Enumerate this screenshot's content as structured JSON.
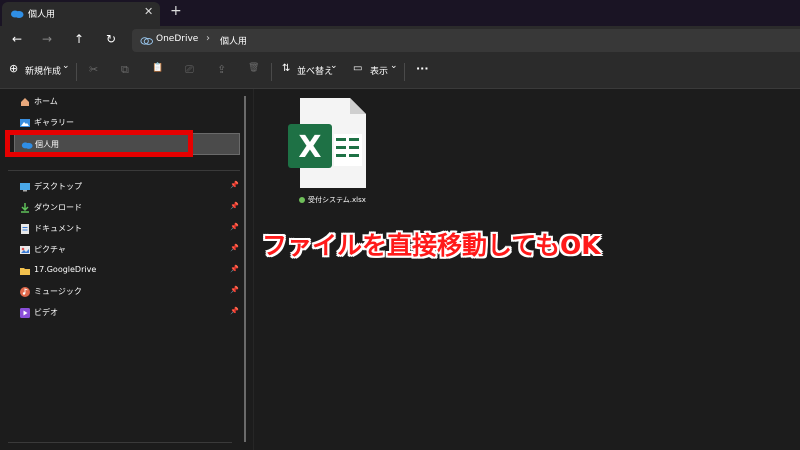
{
  "tab": {
    "title": "個人用",
    "close": "✕",
    "new": "+"
  },
  "nav": {
    "back": "←",
    "forward": "→",
    "up": "↑",
    "refresh": "↻"
  },
  "address": {
    "root": "OneDrive",
    "separator": "›",
    "folder": "個人用"
  },
  "toolbar": {
    "new_icon": "⊕",
    "new_label": "新規作成",
    "new_chevron": "⌄",
    "cut": "✂",
    "copy": "⧉",
    "paste": "📋",
    "rename": "⎚",
    "share": "⇪",
    "delete": "🗑",
    "sort_icon": "⇅",
    "sort_label": "並べ替え",
    "sort_chevron": "⌄",
    "view_icon": "▭",
    "view_label": "表示",
    "view_chevron": "⌄",
    "more": "···"
  },
  "sidebar": {
    "items": [
      {
        "label": "ホーム",
        "icon": "home-icon"
      },
      {
        "label": "ギャラリー",
        "icon": "gallery-icon"
      },
      {
        "label": "個人用",
        "icon": "onedrive-cloud-icon"
      },
      {
        "label": "デスクトップ",
        "icon": "desktop-icon",
        "pin": "📌"
      },
      {
        "label": "ダウンロード",
        "icon": "download-icon",
        "pin": "📌"
      },
      {
        "label": "ドキュメント",
        "icon": "documents-icon",
        "pin": "📌"
      },
      {
        "label": "ピクチャ",
        "icon": "pictures-icon",
        "pin": "📌"
      },
      {
        "label": "17.GoogleDrive",
        "icon": "folder-icon",
        "pin": "📌"
      },
      {
        "label": "ミュージック",
        "icon": "music-icon",
        "pin": "📌"
      },
      {
        "label": "ビデオ",
        "icon": "video-icon",
        "pin": "📌"
      }
    ]
  },
  "file": {
    "name": "受付システム.xlsx",
    "icon_letter": "X",
    "status": "synced"
  },
  "annotation": "ファイルを直接移動してもOK",
  "colors": {
    "accent_red": "#e60000",
    "excel_green": "#1e7145",
    "onedrive_blue": "#2f8ee5"
  }
}
